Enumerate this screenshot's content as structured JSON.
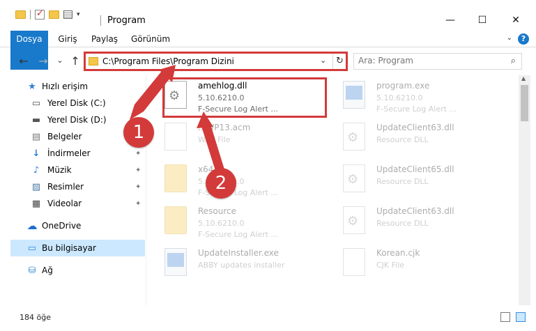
{
  "window": {
    "title": "Program",
    "minimize": "—",
    "maximize": "☐",
    "close": "✕"
  },
  "ribbon": {
    "tabs": [
      "Dosya",
      "Giriş",
      "Paylaş",
      "Görünüm"
    ],
    "help": "?"
  },
  "nav": {
    "back": "←",
    "forward": "→",
    "recent": "⌄",
    "up": "↑",
    "address": "C:\\Program Files\\Program Dizini",
    "dropdown": "⌄",
    "refresh": "↻",
    "search_placeholder": "Ara: Program",
    "search_icon": "⌕"
  },
  "sidebar": {
    "items": [
      {
        "label": "Hızlı erişim",
        "icon": "star-icon",
        "glyph": "★",
        "pinned": false
      },
      {
        "label": "Yerel Disk (C:)",
        "icon": "drive-icon",
        "glyph": "▭",
        "pinned": true
      },
      {
        "label": "Yerel Disk (D:)",
        "icon": "drive-icon",
        "glyph": "▬",
        "pinned": false
      },
      {
        "label": "Belgeler",
        "icon": "documents-icon",
        "glyph": "▤",
        "pinned": false
      },
      {
        "label": "İndirmeler",
        "icon": "downloads-icon",
        "glyph": "↓",
        "pinned": true
      },
      {
        "label": "Müzik",
        "icon": "music-icon",
        "glyph": "♪",
        "pinned": true
      },
      {
        "label": "Resimler",
        "icon": "pictures-icon",
        "glyph": "▨",
        "pinned": true
      },
      {
        "label": "Videolar",
        "icon": "videos-icon",
        "glyph": "▦",
        "pinned": true
      },
      {
        "label": "OneDrive",
        "icon": "cloud-icon",
        "glyph": "☁",
        "pinned": false
      },
      {
        "label": "Bu bilgisayar",
        "icon": "computer-icon",
        "glyph": "▭",
        "pinned": false
      },
      {
        "label": "Ağ",
        "icon": "network-icon",
        "glyph": "⛁",
        "pinned": false
      }
    ],
    "pin_glyph": "📌"
  },
  "files": [
    {
      "name": "amehlog.dll",
      "line1": "5.10.6210.0",
      "line2": "F-Secure Log Alert ...",
      "type": "dll"
    },
    {
      "name": "program.exe",
      "line1": "5.10.6210.0",
      "line2": "F-Secure Log Alert ...",
      "type": "exe"
    },
    {
      "name": "...WP13.acm",
      "line1": "WAV File",
      "line2": "",
      "type": "doc"
    },
    {
      "name": "UpdateClient63.dll",
      "line1": "Resource DLL",
      "line2": "",
      "type": "dll"
    },
    {
      "name": "x64",
      "line1": "5.10.6210.0",
      "line2": "F-Secure Log Alert ...",
      "type": "folder"
    },
    {
      "name": "UpdateClient65.dll",
      "line1": "Resource DLL",
      "line2": "",
      "type": "dll"
    },
    {
      "name": "Resource",
      "line1": "5.10.6210.0",
      "line2": "F-Secure Log Alert ...",
      "type": "folder"
    },
    {
      "name": "UpdateClient63.dll",
      "line1": "Resource DLL",
      "line2": "",
      "type": "dll"
    },
    {
      "name": "UpdateInstaller.exe",
      "line1": "ABBY updates installer",
      "line2": "",
      "type": "exe"
    },
    {
      "name": "Korean.cjk",
      "line1": "CJK File",
      "line2": "",
      "type": "doc"
    }
  ],
  "status": {
    "count": "184 öğe"
  },
  "annotations": {
    "badge1": "1",
    "badge2": "2",
    "color": "#d33a3a"
  }
}
